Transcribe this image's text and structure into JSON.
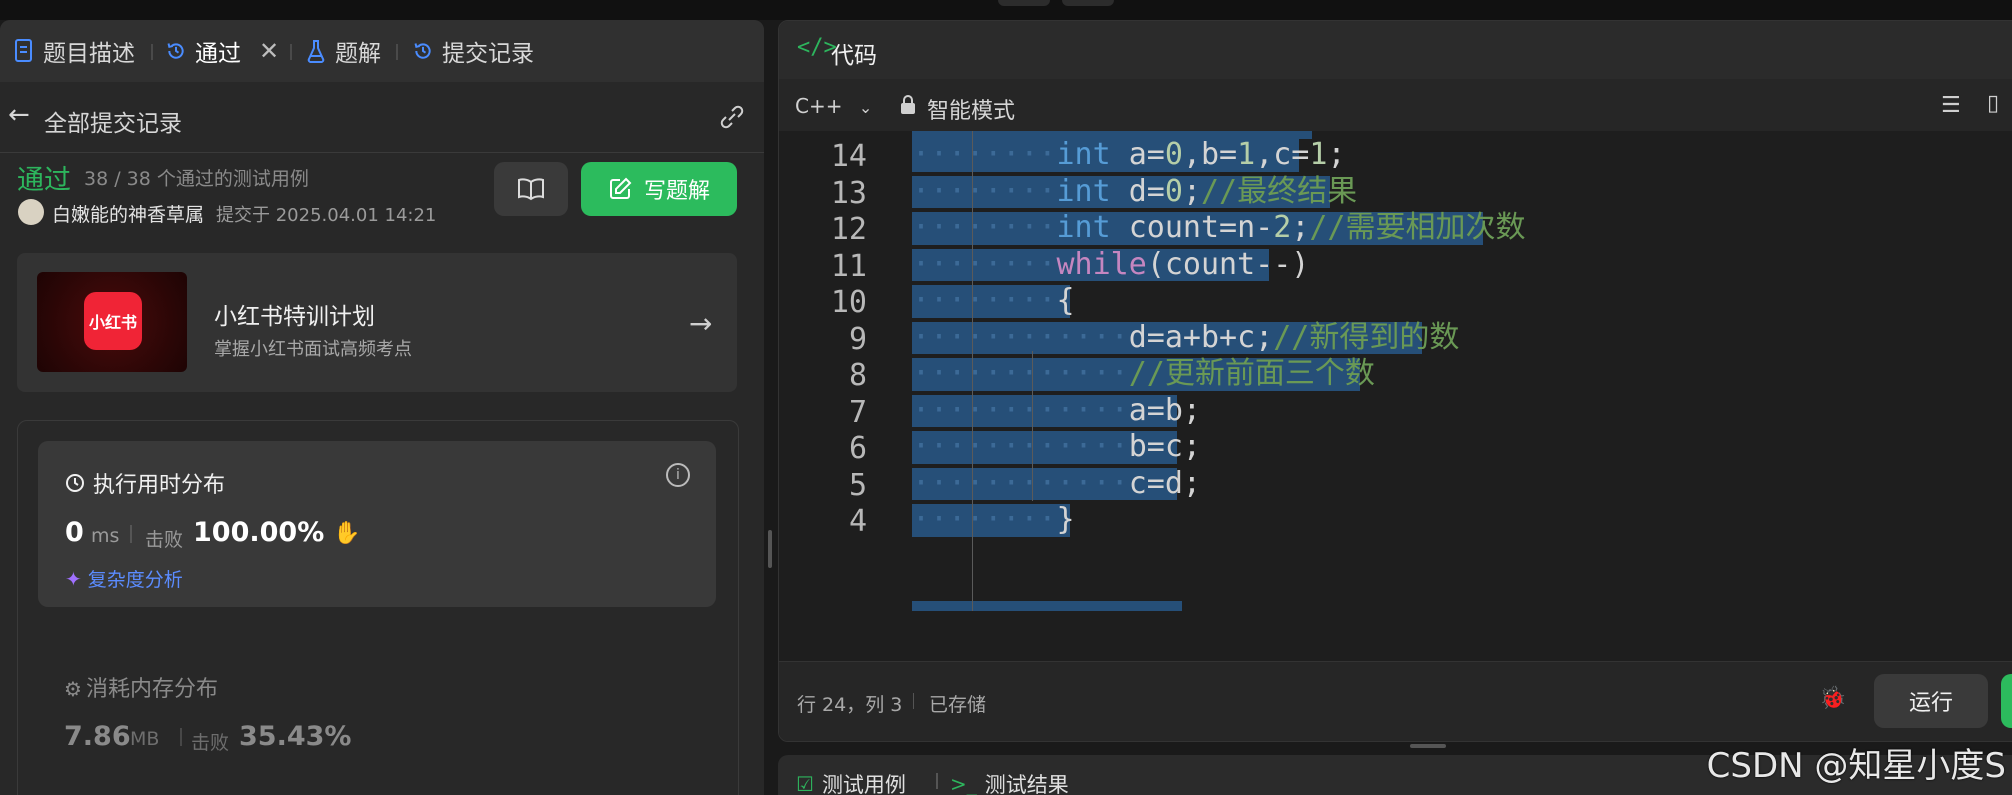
{
  "left_panel": {
    "tabs": [
      {
        "label": "题目描述",
        "icon": "document-icon"
      },
      {
        "label": "通过",
        "icon": "history-icon",
        "closable": true
      },
      {
        "label": "题解",
        "icon": "flask-icon"
      },
      {
        "label": "提交记录",
        "icon": "history-icon"
      }
    ],
    "back_label": "全部提交记录",
    "submission": {
      "status": "通过",
      "testcases": "38 / 38 个通过的测试用例",
      "author": "白嫩能的神香草属",
      "submitted_at": "提交于 2025.04.01 14:21",
      "write_solution_label": "写题解"
    },
    "promo": {
      "logo_text": "小红书",
      "title": "小红书特训计划",
      "subtitle": "掌握小红书面试高频考点"
    },
    "runtime": {
      "title": "执行用时分布",
      "value": "0",
      "unit": "ms",
      "beat_label": "击败",
      "percent": "100.00%",
      "analysis_label": "复杂度分析"
    },
    "memory": {
      "title": "消耗内存分布",
      "value": "7.86",
      "unit": "MB",
      "beat_label": "击败",
      "percent": "35.43%"
    }
  },
  "editor_panel": {
    "title": "代码",
    "language": "C++",
    "mode": "智能模式",
    "lines": [
      {
        "num": "14",
        "indent": 2,
        "tokens": [
          [
            "kw",
            "int"
          ],
          [
            "tx",
            " a="
          ],
          [
            "num",
            "0"
          ],
          [
            "tx",
            ",b="
          ],
          [
            "num",
            "1"
          ],
          [
            "tx",
            ",c="
          ],
          [
            "num",
            "1"
          ],
          [
            "tx",
            ";"
          ]
        ]
      },
      {
        "num": "13",
        "indent": 2,
        "tokens": [
          [
            "kw",
            "int"
          ],
          [
            "tx",
            " d="
          ],
          [
            "num",
            "0"
          ],
          [
            "tx",
            ";"
          ],
          [
            "cm",
            "//最终结果"
          ]
        ]
      },
      {
        "num": "12",
        "indent": 2,
        "tokens": [
          [
            "kw",
            "int"
          ],
          [
            "tx",
            " count=n-"
          ],
          [
            "num",
            "2"
          ],
          [
            "tx",
            ";"
          ],
          [
            "cm",
            "//需要相加次数"
          ]
        ]
      },
      {
        "num": "11",
        "indent": 2,
        "tokens": [
          [
            "kw2",
            "while"
          ],
          [
            "tx",
            "(count--)"
          ]
        ]
      },
      {
        "num": "10",
        "indent": 2,
        "tokens": [
          [
            "tx",
            "{"
          ]
        ]
      },
      {
        "num": "9",
        "indent": 3,
        "tokens": [
          [
            "tx",
            "d=a+b+c;"
          ],
          [
            "cm",
            "//新得到的数"
          ]
        ]
      },
      {
        "num": "8",
        "indent": 3,
        "tokens": [
          [
            "cm",
            "//更新前面三个数"
          ]
        ]
      },
      {
        "num": "7",
        "indent": 3,
        "tokens": [
          [
            "tx",
            "a=b;"
          ]
        ]
      },
      {
        "num": "6",
        "indent": 3,
        "tokens": [
          [
            "tx",
            "b=c;"
          ]
        ]
      },
      {
        "num": "5",
        "indent": 3,
        "tokens": [
          [
            "tx",
            "c=d;"
          ]
        ]
      },
      {
        "num": "4",
        "indent": 2,
        "tokens": [
          [
            "tx",
            "}"
          ]
        ]
      }
    ],
    "status": "行 24，列 3",
    "saved": "已存储",
    "run_label": "运行"
  },
  "bottom_panel": {
    "tabs": [
      {
        "label": "测试用例",
        "icon": "checkbox-icon"
      },
      {
        "label": "测试结果",
        "icon": "terminal-icon"
      }
    ]
  },
  "watermark": "CSDN @知星小度S",
  "colors": {
    "accent_green": "#2cbb5d",
    "selection": "#264f78",
    "keyword": "#569cd6",
    "comment": "#6a9955",
    "number": "#b5cea8",
    "control": "#c586c0"
  }
}
